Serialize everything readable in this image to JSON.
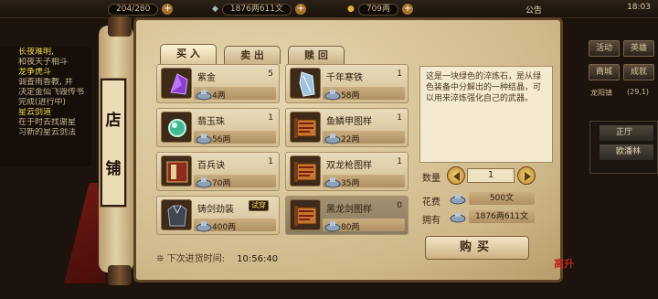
{
  "topbar": {
    "stat1": "204/280",
    "stat2": "1876两611文",
    "stat3": "709两",
    "announce": "公告",
    "time": "18:03"
  },
  "quests": [
    {
      "text": "长夜难明,",
      "title": true
    },
    {
      "text": "和夜天子相斗",
      "title": false
    },
    {
      "text": "龙争虎斗",
      "title": true
    },
    {
      "text": "调查雨香教, 并",
      "title": false
    },
    {
      "text": "决定金仙飞毁传书",
      "title": false
    },
    {
      "text": "完成(进行中)",
      "title": false
    },
    {
      "text": "星云剑道",
      "title": true
    },
    {
      "text": "在于时去找谢星",
      "title": false
    },
    {
      "text": "习新的星云剑法",
      "title": false
    }
  ],
  "right_menu": {
    "activity": "活动",
    "rank": "英雄",
    "mall": "商城",
    "tasks": "成就",
    "kingdom": "龙阳镇",
    "coords": "(29,1)",
    "item1": "正厅",
    "item2": "欧潘林"
  },
  "shop": {
    "sign_top": "店",
    "sign_bottom": "铺",
    "tabs": [
      "买 入",
      "卖 出",
      "赎 回"
    ],
    "items": [
      {
        "name": "紫金",
        "count": "5",
        "price": "4两",
        "icon": "purple-crystal-icon"
      },
      {
        "name": "千年寒铁",
        "count": "1",
        "price": "58两",
        "icon": "ice-crystal-icon"
      },
      {
        "name": "翡玉珠",
        "count": "1",
        "price": "56两",
        "icon": "jade-orb-icon"
      },
      {
        "name": "鱼鳞甲图样",
        "count": "1",
        "price": "22两",
        "icon": "scroll-icon"
      },
      {
        "name": "百兵诀",
        "count": "1",
        "price": "70两",
        "icon": "book-icon"
      },
      {
        "name": "双龙枪图样",
        "count": "1",
        "price": "35两",
        "icon": "scroll-icon"
      },
      {
        "name": "铸剑劲装",
        "count": "",
        "price": "400两",
        "icon": "armor-icon",
        "tag": "试穿"
      },
      {
        "name": "黑龙剑图样",
        "count": "0",
        "price": "80两",
        "icon": "scroll-icon"
      }
    ],
    "restock_label": "下次进货时间:",
    "restock_time": "10:56:40",
    "description": "这是一块绿色的淬炼石，是从绿色装备中分解出的一种结晶，可以用来淬炼强化自己的武器。",
    "qty_label": "数量",
    "qty_value": "1",
    "cost_label": "花费",
    "cost_value": "500文",
    "own_label": "拥有",
    "own_value": "1876两611文",
    "buy_label": "购买",
    "seal": "高升"
  }
}
